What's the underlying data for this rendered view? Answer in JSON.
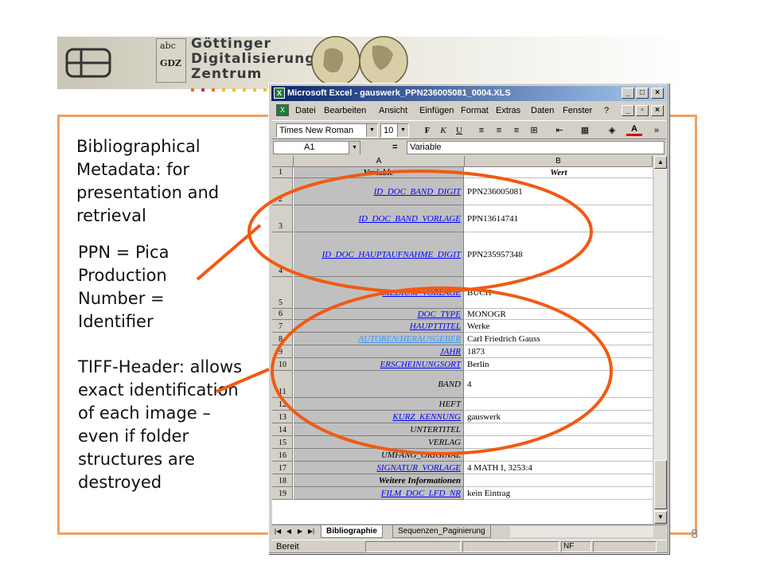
{
  "header": {
    "sub_logo": "SUB",
    "gdz_letters": [
      "abc",
      "GDZ"
    ],
    "gdz_title_lines": [
      "Göttinger",
      "Digitalisierungs-",
      "Zentrum"
    ]
  },
  "notes": {
    "metadata": "Bibliographical Metadata: for presentation and retrieval",
    "ppn": "PPN = Pica Production Number = Identifier",
    "tiff": "TIFF-Header: allows exact identification of each image – even if folder structures are destroyed"
  },
  "slide_number": "8",
  "excel": {
    "title": "Microsoft Excel - gauswerk_PPN236005081_0004.XLS",
    "menu": [
      "Datei",
      "Bearbeiten",
      "Ansicht",
      "Einfügen",
      "Format",
      "Extras",
      "Daten",
      "Fenster",
      "?"
    ],
    "font_name": "Times New Roman",
    "font_size": "10",
    "name_box": "A1",
    "formula_eq": "=",
    "formula_value": "Variable",
    "columns": [
      "A",
      "B"
    ],
    "rows": [
      {
        "num": "1",
        "a": "Variable",
        "b": "Wert"
      },
      {
        "num": "2",
        "a": "ID_DOC_BAND_DIGIT",
        "b": "PPN236005081"
      },
      {
        "num": "3",
        "a": "ID_DOC_BAND_VORLAGE",
        "b": "PPN13614741"
      },
      {
        "num": "4",
        "a": "ID_DOC_HAUPTAUFNAHME_DIGIT",
        "b": "PPN235957348"
      },
      {
        "num": "5",
        "a": "MEDIUM_VORLAGE",
        "b": "BUCH"
      },
      {
        "num": "6",
        "a": "DOC_TYPE",
        "b": "MONOGR"
      },
      {
        "num": "7",
        "a": "HAUPTTITEL",
        "b": "Werke"
      },
      {
        "num": "8",
        "a": "AUTOREN/HERAUSGEBER",
        "b": "Carl Friedrich Gauss"
      },
      {
        "num": "9",
        "a": "JAHR",
        "b": "1873"
      },
      {
        "num": "10",
        "a": "ERSCHEINUNGSORT",
        "b": "Berlin"
      },
      {
        "num": "11",
        "a": "BAND",
        "b": "4"
      },
      {
        "num": "12",
        "a": "HEFT",
        "b": ""
      },
      {
        "num": "13",
        "a": "KURZ_KENNUNG",
        "b": "gauswerk"
      },
      {
        "num": "14",
        "a": "UNTERTITEL",
        "b": ""
      },
      {
        "num": "15",
        "a": "VERLAG",
        "b": ""
      },
      {
        "num": "16",
        "a": "UMFANG_ORIGINAL",
        "b": ""
      },
      {
        "num": "17",
        "a": "SIGNATUR_VORLAGE",
        "b": "4 MATH I, 3253:4"
      },
      {
        "num": "18",
        "a": "Weitere Informationen",
        "b": ""
      },
      {
        "num": "19",
        "a": "FILM_DOC_LFD_NR",
        "b": "kein Eintrag"
      }
    ],
    "sheet_tabs": [
      "Bibliographie",
      "Sequenzen_Paginierung"
    ],
    "status": "Bereit",
    "status_nf": "NF",
    "colors": {
      "blue_link": "#0000ff",
      "light_blue": "#3399ff",
      "accent_orange": "#f05a14"
    }
  }
}
